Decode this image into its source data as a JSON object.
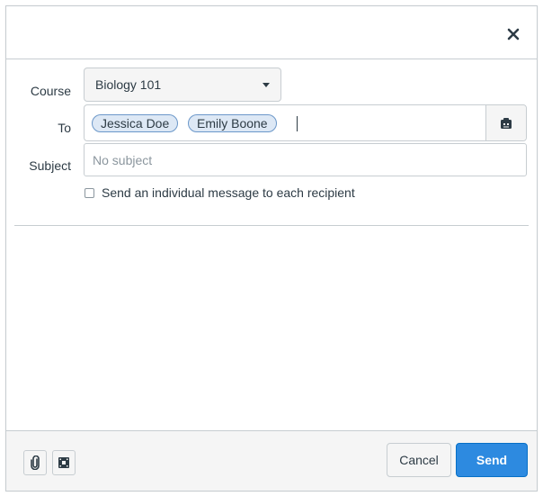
{
  "dialog": {
    "close_icon": "close-icon"
  },
  "form": {
    "course_label": "Course",
    "course_value": "Biology 101",
    "to_label": "To",
    "recipients": [
      "Jessica Doe",
      "Emily Boone"
    ],
    "address_book_icon": "address-book-icon",
    "subject_label": "Subject",
    "subject_value": "",
    "subject_placeholder": "No subject",
    "individual_label": "Send an individual message to each recipient",
    "individual_checked": false
  },
  "footer": {
    "attach_icon": "paperclip-icon",
    "media_icon": "media-icon",
    "cancel_label": "Cancel",
    "send_label": "Send"
  },
  "colors": {
    "send_button": "#2d8ae0",
    "token_bg": "#dde8f5",
    "token_border": "#6b97c9",
    "border": "#c7cdd1"
  }
}
